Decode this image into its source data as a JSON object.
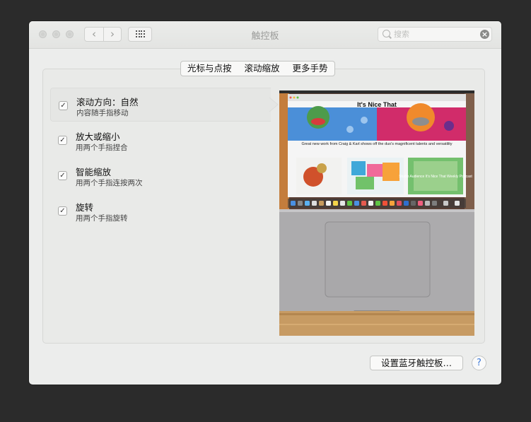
{
  "window": {
    "title": "触控板",
    "search_placeholder": "搜索",
    "search_value": ""
  },
  "tabs": [
    {
      "label": "光标与点按"
    },
    {
      "label": "滚动缩放",
      "selected": true
    },
    {
      "label": "更多手势"
    }
  ],
  "options": [
    {
      "title": "滚动方向：自然",
      "subtitle": "内容随手指移动",
      "checked": true,
      "active": true
    },
    {
      "title": "放大或缩小",
      "subtitle": "用两个手指捏合",
      "checked": true
    },
    {
      "title": "智能缩放",
      "subtitle": "用两个手指连按两次",
      "checked": true
    },
    {
      "title": "旋转",
      "subtitle": "用两个手指旋转",
      "checked": true
    }
  ],
  "preview": {
    "site_title": "It's Nice That",
    "headline": "Great new work from Craig & Karl shows off the duo's magnificent talents and versatility",
    "promo": "Studio Audience It's Nice That Weekly Podcast"
  },
  "buttons": {
    "bluetooth": "设置蓝牙触控板…",
    "help": "?"
  },
  "colors": {
    "window_bg": "#ecedec",
    "desktop_bg": "#2b2b2b",
    "help_blue": "#3a78d8"
  }
}
